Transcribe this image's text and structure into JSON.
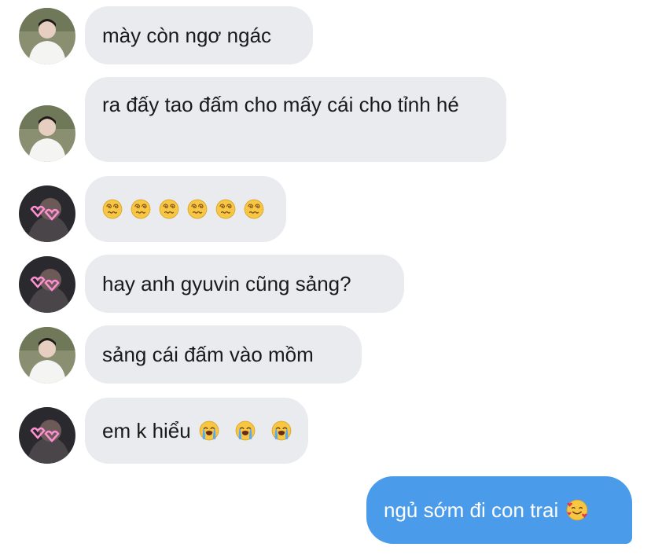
{
  "messages": [
    {
      "sender": "friend_a",
      "text": "mày còn ngơ ngác"
    },
    {
      "sender": "friend_a",
      "text": "ra đấy tao đấm cho mấy cái cho tỉnh hé"
    },
    {
      "sender": "friend_b",
      "text": "",
      "emoji": "dizzy-face-icon",
      "emoji_count": 6
    },
    {
      "sender": "friend_b",
      "text": "hay anh gyuvin cũng sảng?"
    },
    {
      "sender": "friend_a",
      "text": "sảng cái đấm vào mồm"
    },
    {
      "sender": "friend_b",
      "text": "em k hiểu",
      "emoji": "loudly-crying-face-icon",
      "emoji_count": 3
    },
    {
      "sender": "me",
      "text": "ngủ sớm đi con trai",
      "emoji": "smiling-face-with-hearts-icon",
      "emoji_count": 1
    }
  ],
  "colors": {
    "incoming_bubble": "#e9ebef",
    "outgoing_bubble": "#4a9bea",
    "incoming_text": "#1a1a1a",
    "outgoing_text": "#ffffff"
  }
}
